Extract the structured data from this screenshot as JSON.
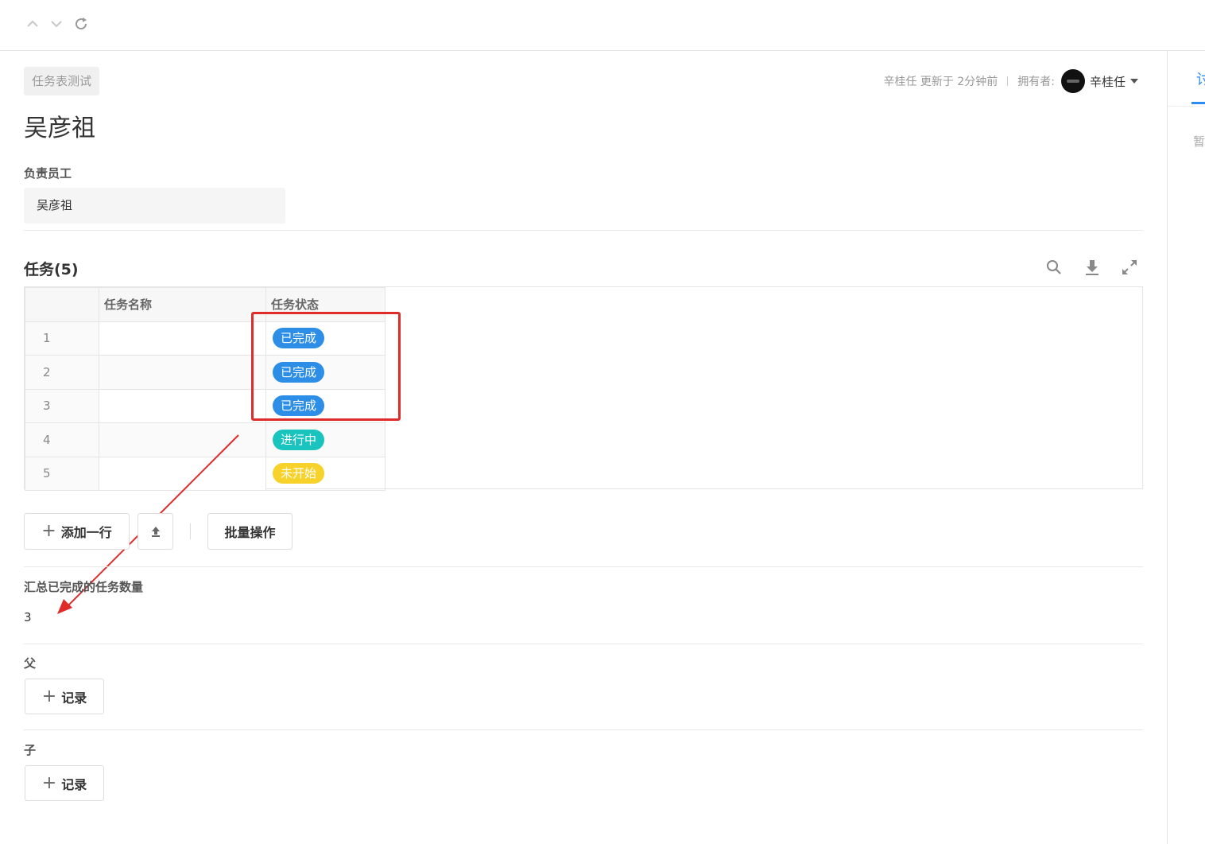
{
  "breadcrumb": "任务表测试",
  "title": "吴彦祖",
  "meta": {
    "updated_by": "辛桂任 更新于 2分钟前",
    "owner_label": "拥有者:",
    "owner_name": "辛桂任"
  },
  "fields": {
    "responsible_label": "负责员工",
    "responsible_value": "吴彦祖"
  },
  "tasks": {
    "title": "任务(5)",
    "columns": [
      "任务名称",
      "任务状态"
    ],
    "rows": [
      {
        "index": "1",
        "name": "",
        "status": "已完成",
        "status_color": "#2d8ee8"
      },
      {
        "index": "2",
        "name": "",
        "status": "已完成",
        "status_color": "#2d8ee8"
      },
      {
        "index": "3",
        "name": "",
        "status": "已完成",
        "status_color": "#2d8ee8"
      },
      {
        "index": "4",
        "name": "",
        "status": "进行中",
        "status_color": "#19c4be"
      },
      {
        "index": "5",
        "name": "",
        "status": "未开始",
        "status_color": "#f7d22b"
      }
    ],
    "add_row_label": "添加一行",
    "batch_label": "批量操作"
  },
  "summary": {
    "label": "汇总已完成的任务数量",
    "value": "3"
  },
  "parent": {
    "label": "父",
    "add_label": "记录"
  },
  "child": {
    "label": "子",
    "add_label": "记录"
  },
  "side_panel": {
    "tab_label": "讨",
    "empty_text": "暂"
  },
  "colors": {
    "accent": "#2d8cf0",
    "annotation": "#e02b2b"
  }
}
